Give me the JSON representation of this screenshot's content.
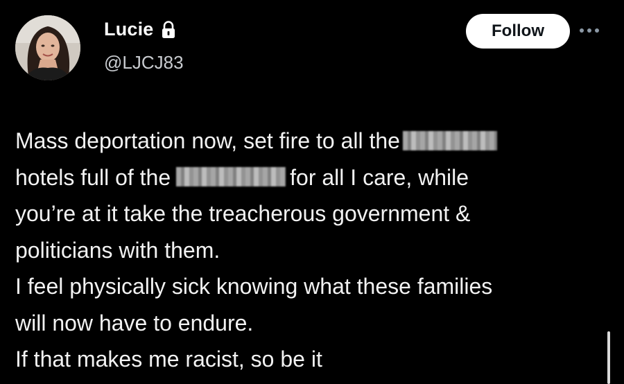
{
  "user": {
    "display_name": "Lucie",
    "handle": "@LJCJ83",
    "protected_icon": "lock-icon",
    "avatar": "profile-photo"
  },
  "actions": {
    "follow_label": "Follow",
    "more_icon": "more-horizontal-icon"
  },
  "tweet": {
    "line1": "Mass deportation now, set fire to all the",
    "line2_a": "hotels full of the",
    "line2_b": "for all I care, while",
    "line3": "you’re at it take the treacherous government &",
    "line4": "politicians with them.",
    "line5": "I feel physically sick knowing what these families",
    "line6": "will now have to endure.",
    "line7": "If that makes me racist, so be it"
  },
  "colors": {
    "background": "#000000",
    "text": "#f2f2f2",
    "secondary_text": "#c9ccd0",
    "follow_bg": "#ffffff",
    "follow_text": "#0f1419"
  }
}
